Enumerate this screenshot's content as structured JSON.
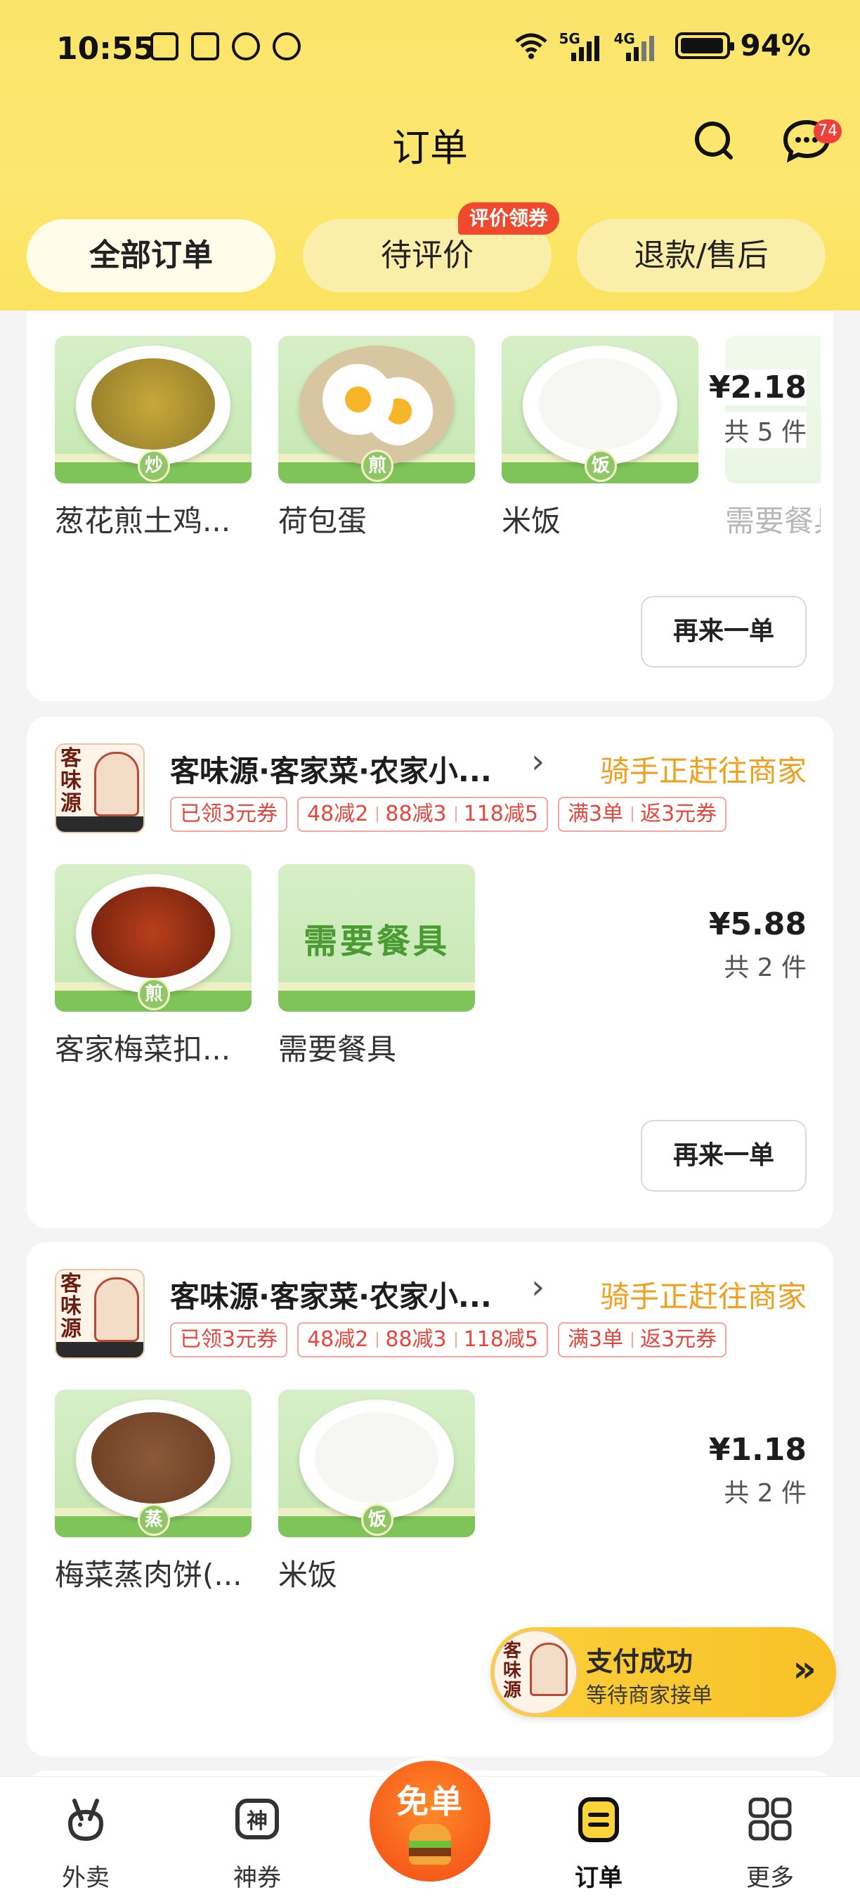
{
  "status_bar": {
    "time": "10:55",
    "network_1": "5G",
    "network_2": "4G",
    "battery": "94%"
  },
  "header": {
    "title": "订单",
    "message_badge": "74",
    "tabs": [
      {
        "label": "全部订单",
        "active": true
      },
      {
        "label": "待评价",
        "active": false,
        "tag": "评价领券"
      },
      {
        "label": "退款/售后",
        "active": false
      }
    ]
  },
  "orders": [
    {
      "items": [
        {
          "name": "葱花煎土鸡...",
          "seal": "炒"
        },
        {
          "name": "荷包蛋",
          "seal": "煎"
        },
        {
          "name": "米饭",
          "seal": "饭"
        },
        {
          "name": "需要餐具",
          "seal": ""
        }
      ],
      "price": "¥2.18",
      "qty": "共 5 件",
      "reorder_label": "再来一单"
    },
    {
      "shop": {
        "logo_text": "客味源",
        "name": "客味源·客家菜·农家小...",
        "status": "骑手正赶往商家",
        "coupon": "已领3元券",
        "discounts": [
          "48减2",
          "88减3",
          "118减5"
        ],
        "rebate": [
          "满3单",
          "返3元券"
        ]
      },
      "items": [
        {
          "name": "客家梅菜扣...",
          "seal": "煎"
        },
        {
          "name": "需要餐具",
          "seal": "",
          "banner": "需要餐具"
        }
      ],
      "price": "¥5.88",
      "qty": "共 2 件",
      "reorder_label": "再来一单"
    },
    {
      "shop": {
        "logo_text": "客味源",
        "name": "客味源·客家菜·农家小...",
        "status": "骑手正赶往商家",
        "coupon": "已领3元券",
        "discounts": [
          "48减2",
          "88减3",
          "118减5"
        ],
        "rebate": [
          "满3单",
          "返3元券"
        ]
      },
      "items": [
        {
          "name": "梅菜蒸肉饼(...",
          "seal": "蒸"
        },
        {
          "name": "米饭",
          "seal": "饭"
        }
      ],
      "price": "¥1.18",
      "qty": "共 2 件"
    }
  ],
  "payment_float": {
    "logo_text": "客味源",
    "title": "支付成功",
    "subtitle": "等待商家接单",
    "arrow": "»"
  },
  "bottom_nav": {
    "items": [
      {
        "label": "外卖",
        "icon": "rabbit-icon"
      },
      {
        "label": "神券",
        "icon": "coupon-icon",
        "icon_text": "神"
      },
      {
        "label": "订单",
        "icon": "order-icon",
        "active": true
      },
      {
        "label": "更多",
        "icon": "grid-icon"
      }
    ],
    "center": {
      "label": "免单"
    }
  },
  "colors": {
    "header_yellow": "#fce76f",
    "accent_orange": "#f0a020",
    "promo_red": "#e6463d",
    "badge_red": "#f0403c"
  }
}
